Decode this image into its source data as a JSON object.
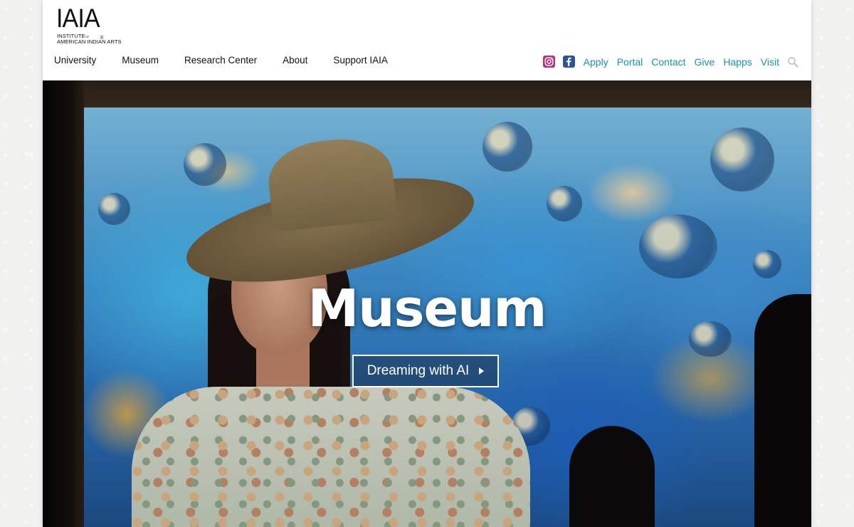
{
  "logo": {
    "mark": "IAIA",
    "registered": "®",
    "line1": "INSTITUTE",
    "line1_small": "OF",
    "line2": "AMERICAN INDIAN ARTS"
  },
  "main_nav": [
    {
      "label": "University"
    },
    {
      "label": "Museum"
    },
    {
      "label": "Research Center"
    },
    {
      "label": "About"
    },
    {
      "label": "Support IAIA"
    }
  ],
  "utility_nav": {
    "social": [
      {
        "icon": "instagram-icon",
        "color": "#b6307a"
      },
      {
        "icon": "facebook-icon",
        "color": "#2b5597"
      }
    ],
    "links": [
      {
        "label": "Apply"
      },
      {
        "label": "Portal"
      },
      {
        "label": "Contact"
      },
      {
        "label": "Give"
      },
      {
        "label": "Happs"
      },
      {
        "label": "Visit"
      }
    ],
    "link_color": "#1796a8",
    "search_icon": "search-icon"
  },
  "hero": {
    "title": "Museum",
    "button_label": "Dreaming with AI"
  }
}
